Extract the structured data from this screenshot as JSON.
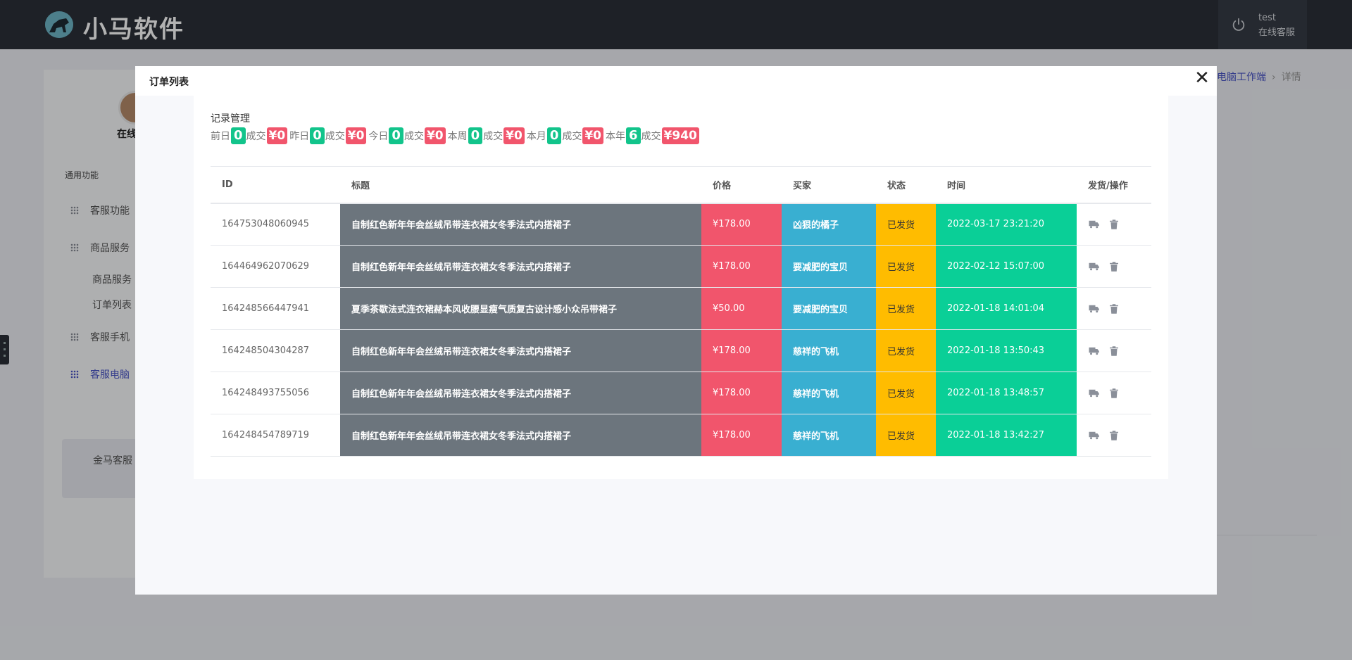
{
  "app": {
    "brand": "小马软件"
  },
  "user": {
    "name": "test",
    "role": "在线客服"
  },
  "sidebar": {
    "online_label": "在线",
    "section_title": "通用功能",
    "items": [
      {
        "label": "客服功能"
      },
      {
        "label": "商品服务"
      },
      {
        "label": "客服手机"
      },
      {
        "label": "客服电脑"
      }
    ],
    "subitems": [
      {
        "label": "商品服务"
      },
      {
        "label": "订单列表"
      }
    ],
    "footer_text": "金马客服"
  },
  "breadcrumb": {
    "link": "电脑工作端",
    "separator": "›",
    "current": "详情"
  },
  "modal": {
    "title": "订单列表",
    "close_glyph": "✕",
    "panel_title": "记录管理",
    "stats": [
      {
        "label": "前日",
        "count": "0",
        "deal_label": "成交",
        "amount": "¥0"
      },
      {
        "label": "昨日",
        "count": "0",
        "deal_label": "成交",
        "amount": "¥0"
      },
      {
        "label": "今日",
        "count": "0",
        "deal_label": "成交",
        "amount": "¥0"
      },
      {
        "label": "本周",
        "count": "0",
        "deal_label": "成交",
        "amount": "¥0"
      },
      {
        "label": "本月",
        "count": "0",
        "deal_label": "成交",
        "amount": "¥0"
      },
      {
        "label": "本年",
        "count": "6",
        "deal_label": "成交",
        "amount": "¥940"
      }
    ],
    "table": {
      "headers": [
        "ID",
        "标题",
        "价格",
        "买家",
        "状态",
        "时间",
        "发货/操作"
      ],
      "rows": [
        {
          "id": "164753048060945",
          "title": "自制红色新年年会丝绒吊带连衣裙女冬季法式内搭裙子",
          "price": "¥178.00",
          "buyer": "凶狠的橘子",
          "status": "已发货",
          "time": "2022-03-17 23:21:20"
        },
        {
          "id": "164464962070629",
          "title": "自制红色新年年会丝绒吊带连衣裙女冬季法式内搭裙子",
          "price": "¥178.00",
          "buyer": "要减肥的宝贝",
          "status": "已发货",
          "time": "2022-02-12 15:07:00"
        },
        {
          "id": "164248566447941",
          "title": "夏季茶歇法式连衣裙赫本风收腰显瘦气质复古设计感小众吊带裙子",
          "price": "¥50.00",
          "buyer": "要减肥的宝贝",
          "status": "已发货",
          "time": "2022-01-18 14:01:04"
        },
        {
          "id": "164248504304287",
          "title": "自制红色新年年会丝绒吊带连衣裙女冬季法式内搭裙子",
          "price": "¥178.00",
          "buyer": "慈祥的飞机",
          "status": "已发货",
          "time": "2022-01-18 13:50:43"
        },
        {
          "id": "164248493755056",
          "title": "自制红色新年年会丝绒吊带连衣裙女冬季法式内搭裙子",
          "price": "¥178.00",
          "buyer": "慈祥的飞机",
          "status": "已发货",
          "time": "2022-01-18 13:48:57"
        },
        {
          "id": "164248454789719",
          "title": "自制红色新年年会丝绒吊带连衣裙女冬季法式内搭裙子",
          "price": "¥178.00",
          "buyer": "慈祥的飞机",
          "status": "已发货",
          "time": "2022-01-18 13:42:27"
        }
      ]
    }
  },
  "colors": {
    "title_cell": "#6c757d",
    "price_cell": "#f1556c",
    "buyer_cell": "#39afd1",
    "status_cell": "#ffbc00",
    "time_cell": "#0acf97",
    "count_badge": "#12c48b",
    "amount_badge": "#f1556c"
  },
  "icons": {
    "ship": "truck-icon",
    "delete": "trash-icon",
    "logout": "power-icon"
  }
}
